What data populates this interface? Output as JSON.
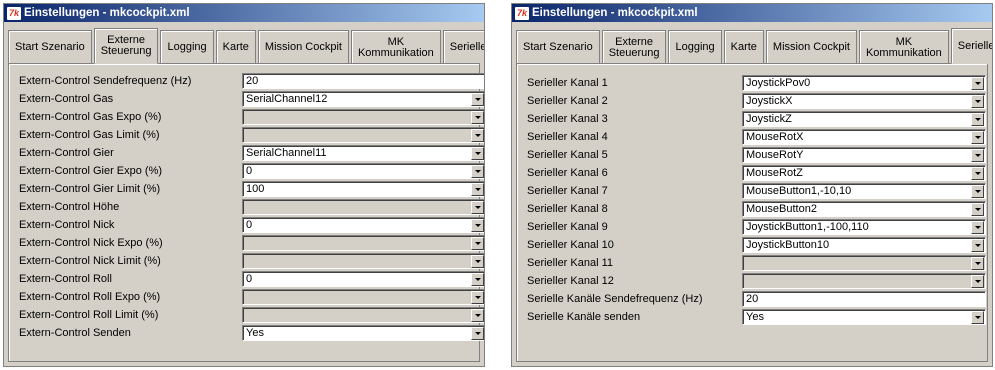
{
  "windows": [
    {
      "title": "Einstellungen - mkcockpit.xml",
      "icon": "app-icon",
      "tabs": [
        {
          "label": "Start Szenario",
          "active": false
        },
        {
          "label": "Externe\nSteuerung",
          "active": true
        },
        {
          "label": "Logging",
          "active": false
        },
        {
          "label": "Karte",
          "active": false
        },
        {
          "label": "Mission Cockpit",
          "active": false
        },
        {
          "label": "MK\nKommunikation",
          "active": false
        },
        {
          "label": "Serielle Kanäle",
          "active": false
        }
      ],
      "rows": [
        {
          "label": "Extern-Control Sendefrequenz (Hz)",
          "type": "text",
          "value": "20"
        },
        {
          "label": "Extern-Control Gas",
          "type": "combo",
          "value": "SerialChannel12"
        },
        {
          "label": "Extern-Control Gas Expo (%)",
          "type": "combo",
          "value": ""
        },
        {
          "label": "Extern-Control Gas Limit (%)",
          "type": "combo",
          "value": ""
        },
        {
          "label": "Extern-Control Gier",
          "type": "combo",
          "value": "SerialChannel11"
        },
        {
          "label": "Extern-Control Gier Expo (%)",
          "type": "combo",
          "value": "0"
        },
        {
          "label": "Extern-Control Gier Limit (%)",
          "type": "combo",
          "value": "100"
        },
        {
          "label": "Extern-Control Höhe",
          "type": "combo",
          "value": ""
        },
        {
          "label": "Extern-Control Nick",
          "type": "combo",
          "value": "0"
        },
        {
          "label": "Extern-Control Nick Expo (%)",
          "type": "combo",
          "value": ""
        },
        {
          "label": "Extern-Control Nick Limit (%)",
          "type": "combo",
          "value": ""
        },
        {
          "label": "Extern-Control Roll",
          "type": "combo",
          "value": "0"
        },
        {
          "label": "Extern-Control Roll Expo (%)",
          "type": "combo",
          "value": ""
        },
        {
          "label": "Extern-Control Roll Limit (%)",
          "type": "combo",
          "value": ""
        },
        {
          "label": "Extern-Control Senden",
          "type": "combo",
          "value": "Yes"
        }
      ]
    },
    {
      "title": "Einstellungen - mkcockpit.xml",
      "icon": "app-icon",
      "tabs": [
        {
          "label": "Start Szenario",
          "active": false
        },
        {
          "label": "Externe\nSteuerung",
          "active": false
        },
        {
          "label": "Logging",
          "active": false
        },
        {
          "label": "Karte",
          "active": false
        },
        {
          "label": "Mission Cockpit",
          "active": false
        },
        {
          "label": "MK\nKommunikation",
          "active": false
        },
        {
          "label": "Serielle Kanäle",
          "active": true
        }
      ],
      "rows": [
        {
          "label": "Serieller Kanal 1",
          "type": "combo",
          "value": "JoystickPov0"
        },
        {
          "label": "Serieller Kanal 2",
          "type": "combo",
          "value": "JoystickX"
        },
        {
          "label": "Serieller Kanal 3",
          "type": "combo",
          "value": "JoystickZ"
        },
        {
          "label": "Serieller Kanal 4",
          "type": "combo",
          "value": "MouseRotX"
        },
        {
          "label": "Serieller Kanal 5",
          "type": "combo",
          "value": "MouseRotY"
        },
        {
          "label": "Serieller Kanal 6",
          "type": "combo",
          "value": "MouseRotZ"
        },
        {
          "label": "Serieller Kanal 7",
          "type": "combo",
          "value": "MouseButton1,-10,10"
        },
        {
          "label": "Serieller Kanal 8",
          "type": "combo",
          "value": "MouseButton2"
        },
        {
          "label": "Serieller Kanal 9",
          "type": "combo",
          "value": "JoystickButton1,-100,110"
        },
        {
          "label": "Serieller Kanal 10",
          "type": "combo",
          "value": "JoystickButton10"
        },
        {
          "label": "Serieller Kanal 11",
          "type": "combo",
          "value": ""
        },
        {
          "label": "Serieller Kanal 12",
          "type": "combo",
          "value": ""
        },
        {
          "label": "Serielle Kanäle Sendefrequenz (Hz)",
          "type": "text",
          "value": "20"
        },
        {
          "label": "Serielle Kanäle senden",
          "type": "combo",
          "value": "Yes"
        }
      ]
    }
  ]
}
